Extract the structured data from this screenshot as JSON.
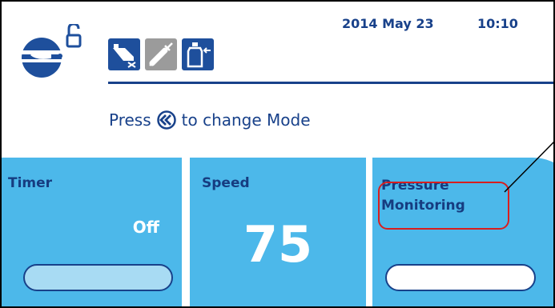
{
  "status": {
    "date": "2014 May 23",
    "time": "10:10"
  },
  "icons": {
    "logo": "pump-lock-logo",
    "modes": [
      "foot-pedal-icon",
      "syringe-icon",
      "bottle-icon"
    ]
  },
  "prompt": {
    "before": "Press",
    "icon": "rewind-icon",
    "after": "to change Mode"
  },
  "panels": {
    "timer": {
      "title": "Timer",
      "value": "Off"
    },
    "speed": {
      "title": "Speed",
      "value": "75"
    },
    "pressure": {
      "title": "Pressure\nMonitoring"
    }
  },
  "colors": {
    "panel": "#4cb8ea",
    "text": "#18418a",
    "highlight": "#d81e1e"
  }
}
